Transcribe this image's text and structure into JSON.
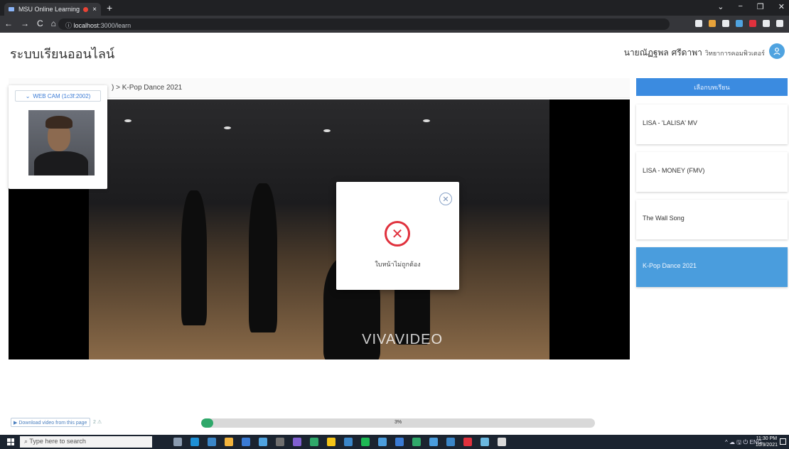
{
  "browser": {
    "tab_title": "MSU Online Learning",
    "tab_close": "×",
    "new_tab": "+",
    "url_host": "localhost",
    "url_path": ":3000/learn",
    "url_info_icon": "ⓘ",
    "window_controls": [
      "⌄",
      "−",
      "❐",
      "✕"
    ],
    "nav_icons": [
      "←",
      "→",
      "C",
      "⌂"
    ],
    "extension_colors": [
      "#e8eaed",
      "#e8a33a",
      "#e8eaed",
      "#4fa3e0",
      "#e0313d",
      "#e8eaed",
      "#e8eaed"
    ]
  },
  "header": {
    "app_title": "ระบบเรียนออนไลน์",
    "user_name": "นายณัฏฐพล ศรีดาพา",
    "user_faculty": "วิทยาการคอมพิวเตอร์",
    "avatar_icon": "person-icon"
  },
  "webcam": {
    "selector_label": "WEB CAM (1c3f:2002)",
    "selector_icon": "chevron-down-icon"
  },
  "breadcrumb": {
    "separator_prefix": ") >",
    "current": "K-Pop Dance 2021"
  },
  "video": {
    "watermark": "VIVAVIDEO"
  },
  "modal": {
    "close_icon": "close-icon",
    "error_icon": "error-x-icon",
    "message": "ใบหน้าไม่ถูกต้อง"
  },
  "playlist": {
    "header": "เลือกบทเรียน",
    "items": [
      {
        "label": "LISA - 'LALISA' MV",
        "active": false
      },
      {
        "label": "LISA - MONEY (FMV)",
        "active": false
      },
      {
        "label": "The Wall Song",
        "active": false
      },
      {
        "label": "K-Pop Dance 2021",
        "active": true
      }
    ]
  },
  "bottom": {
    "download_label": "▶ Download video from this page",
    "download_extra": "2 ⚠",
    "progress_percent": 3,
    "progress_label": "3%"
  },
  "taskbar": {
    "search_placeholder": "Type here to search",
    "app_colors": [
      "#8a9bb0",
      "#1e90d6",
      "#3a86c8",
      "#f3b43d",
      "#3a7bd5",
      "#4fa3e0",
      "#6f6f6f",
      "#8060d0",
      "#2fa86a",
      "#f5c518",
      "#3a86c8",
      "#1db954",
      "#4a9ddd",
      "#3a7bd5",
      "#2fa86a",
      "#4a9ddd",
      "#3a86c8",
      "#e0313d",
      "#6bb8e0",
      "#d9d9d9"
    ],
    "tray_text": "^ ☁ 🖫 ⏻ ENG",
    "time": "11:30 PM",
    "date": "10/9/2021"
  }
}
